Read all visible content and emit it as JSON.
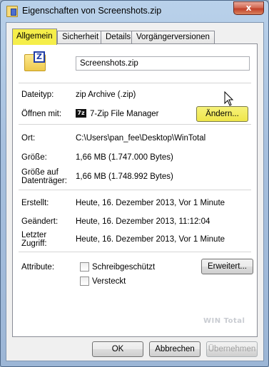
{
  "window": {
    "title": "Eigenschaften von Screenshots.zip",
    "close_label": "x"
  },
  "tabs": [
    {
      "label": "Allgemein",
      "active": true
    },
    {
      "label": "Sicherheit",
      "active": false
    },
    {
      "label": "Details",
      "active": false
    },
    {
      "label": "Vorgängerversionen",
      "active": false
    }
  ],
  "general": {
    "file_icon": "zip-folder-icon",
    "file_name": "Screenshots.zip",
    "type_label": "Dateityp:",
    "type_value": "zip Archive (.zip)",
    "open_with_label": "Öffnen mit:",
    "open_with_icon_text": "7z",
    "open_with_value": "7-Zip File Manager",
    "change_button": "Ändern...",
    "location_label": "Ort:",
    "location_value": "C:\\Users\\pan_fee\\Desktop\\WinTotal",
    "size_label": "Größe:",
    "size_value": "1,66 MB (1.747.000 Bytes)",
    "size_on_disk_label_1": "Größe auf",
    "size_on_disk_label_2": "Datenträger:",
    "size_on_disk_value": "1,66 MB (1.748.992 Bytes)",
    "created_label": "Erstellt:",
    "created_value": "Heute, 16. Dezember 2013, Vor 1 Minute",
    "modified_label": "Geändert:",
    "modified_value": "Heute, 16. Dezember 2013, 11:12:04",
    "accessed_label_1": "Letzter",
    "accessed_label_2": "Zugriff:",
    "accessed_value": "Heute, 16. Dezember 2013, Vor 1 Minute",
    "attributes_label": "Attribute:",
    "readonly_label": "Schreibgeschützt",
    "readonly_checked": false,
    "hidden_label": "Versteckt",
    "hidden_checked": false,
    "advanced_button": "Erweitert...",
    "watermark": "WIN Total"
  },
  "footer": {
    "ok": "OK",
    "cancel": "Abbrechen",
    "apply": "Übernehmen"
  },
  "colors": {
    "highlight": "#f5ee4a",
    "window_frame": "#a7c0de",
    "close_button": "#c2412a"
  }
}
